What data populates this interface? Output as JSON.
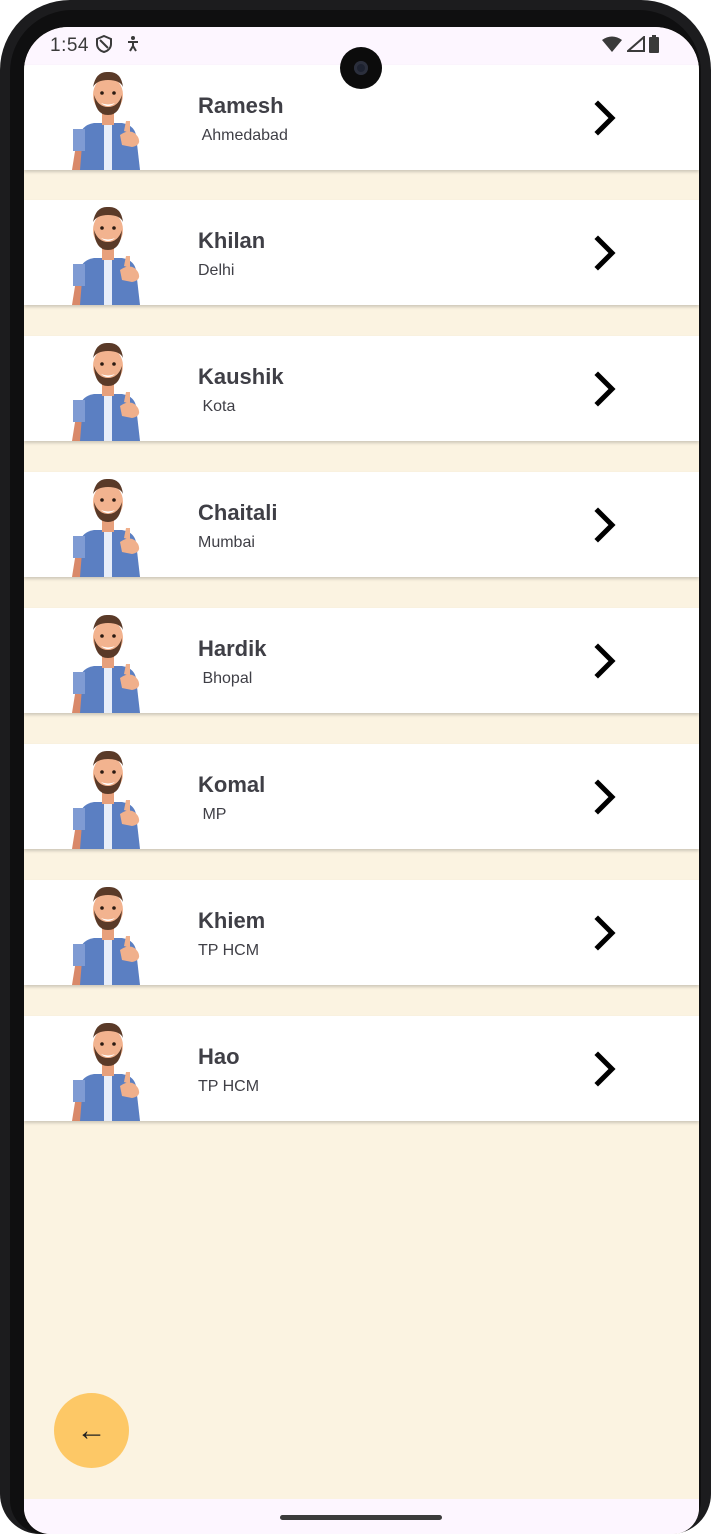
{
  "status_bar": {
    "time": "1:54",
    "left_icons": [
      "shield-icon",
      "accessibility-icon"
    ],
    "right_icons": [
      "wifi-icon",
      "signal-icon",
      "battery-icon"
    ]
  },
  "people": [
    {
      "name": "Ramesh",
      "city": " Ahmedabad"
    },
    {
      "name": "Khilan",
      "city": "Delhi"
    },
    {
      "name": "Kaushik",
      "city": " Kota"
    },
    {
      "name": "Chaitali",
      "city": "Mumbai"
    },
    {
      "name": "Hardik",
      "city": " Bhopal"
    },
    {
      "name": "Komal",
      "city": " MP"
    },
    {
      "name": "Khiem",
      "city": "TP HCM"
    },
    {
      "name": "Hao",
      "city": "TP HCM"
    }
  ],
  "fab": {
    "icon": "←"
  },
  "colors": {
    "background": "#fbf3e1",
    "card": "#ffffff",
    "fab": "#fdc866",
    "text": "#3f3f46"
  }
}
